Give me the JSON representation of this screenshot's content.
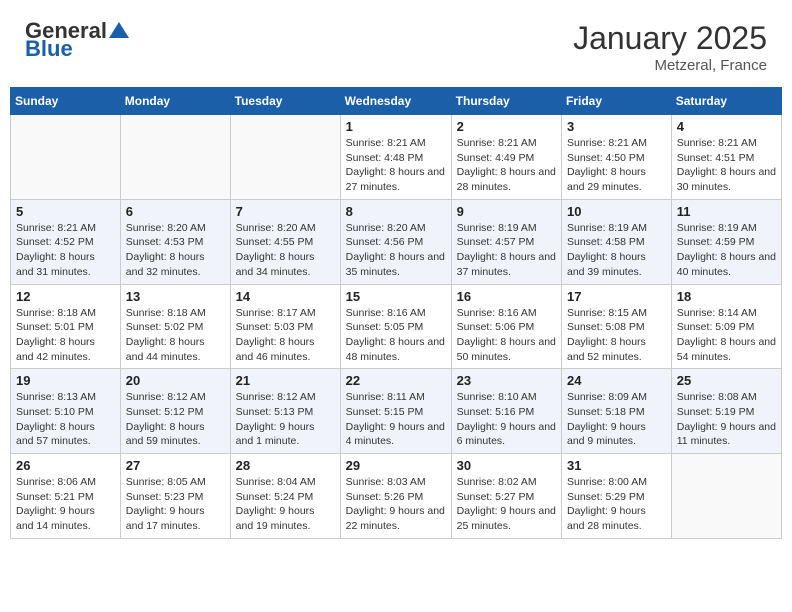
{
  "header": {
    "logo_general": "General",
    "logo_blue": "Blue",
    "month": "January 2025",
    "location": "Metzeral, France"
  },
  "weekdays": [
    "Sunday",
    "Monday",
    "Tuesday",
    "Wednesday",
    "Thursday",
    "Friday",
    "Saturday"
  ],
  "weeks": [
    [
      {
        "day": null,
        "sunrise": null,
        "sunset": null,
        "daylight": null
      },
      {
        "day": null,
        "sunrise": null,
        "sunset": null,
        "daylight": null
      },
      {
        "day": null,
        "sunrise": null,
        "sunset": null,
        "daylight": null
      },
      {
        "day": "1",
        "sunrise": "Sunrise: 8:21 AM",
        "sunset": "Sunset: 4:48 PM",
        "daylight": "Daylight: 8 hours and 27 minutes."
      },
      {
        "day": "2",
        "sunrise": "Sunrise: 8:21 AM",
        "sunset": "Sunset: 4:49 PM",
        "daylight": "Daylight: 8 hours and 28 minutes."
      },
      {
        "day": "3",
        "sunrise": "Sunrise: 8:21 AM",
        "sunset": "Sunset: 4:50 PM",
        "daylight": "Daylight: 8 hours and 29 minutes."
      },
      {
        "day": "4",
        "sunrise": "Sunrise: 8:21 AM",
        "sunset": "Sunset: 4:51 PM",
        "daylight": "Daylight: 8 hours and 30 minutes."
      }
    ],
    [
      {
        "day": "5",
        "sunrise": "Sunrise: 8:21 AM",
        "sunset": "Sunset: 4:52 PM",
        "daylight": "Daylight: 8 hours and 31 minutes."
      },
      {
        "day": "6",
        "sunrise": "Sunrise: 8:20 AM",
        "sunset": "Sunset: 4:53 PM",
        "daylight": "Daylight: 8 hours and 32 minutes."
      },
      {
        "day": "7",
        "sunrise": "Sunrise: 8:20 AM",
        "sunset": "Sunset: 4:55 PM",
        "daylight": "Daylight: 8 hours and 34 minutes."
      },
      {
        "day": "8",
        "sunrise": "Sunrise: 8:20 AM",
        "sunset": "Sunset: 4:56 PM",
        "daylight": "Daylight: 8 hours and 35 minutes."
      },
      {
        "day": "9",
        "sunrise": "Sunrise: 8:19 AM",
        "sunset": "Sunset: 4:57 PM",
        "daylight": "Daylight: 8 hours and 37 minutes."
      },
      {
        "day": "10",
        "sunrise": "Sunrise: 8:19 AM",
        "sunset": "Sunset: 4:58 PM",
        "daylight": "Daylight: 8 hours and 39 minutes."
      },
      {
        "day": "11",
        "sunrise": "Sunrise: 8:19 AM",
        "sunset": "Sunset: 4:59 PM",
        "daylight": "Daylight: 8 hours and 40 minutes."
      }
    ],
    [
      {
        "day": "12",
        "sunrise": "Sunrise: 8:18 AM",
        "sunset": "Sunset: 5:01 PM",
        "daylight": "Daylight: 8 hours and 42 minutes."
      },
      {
        "day": "13",
        "sunrise": "Sunrise: 8:18 AM",
        "sunset": "Sunset: 5:02 PM",
        "daylight": "Daylight: 8 hours and 44 minutes."
      },
      {
        "day": "14",
        "sunrise": "Sunrise: 8:17 AM",
        "sunset": "Sunset: 5:03 PM",
        "daylight": "Daylight: 8 hours and 46 minutes."
      },
      {
        "day": "15",
        "sunrise": "Sunrise: 8:16 AM",
        "sunset": "Sunset: 5:05 PM",
        "daylight": "Daylight: 8 hours and 48 minutes."
      },
      {
        "day": "16",
        "sunrise": "Sunrise: 8:16 AM",
        "sunset": "Sunset: 5:06 PM",
        "daylight": "Daylight: 8 hours and 50 minutes."
      },
      {
        "day": "17",
        "sunrise": "Sunrise: 8:15 AM",
        "sunset": "Sunset: 5:08 PM",
        "daylight": "Daylight: 8 hours and 52 minutes."
      },
      {
        "day": "18",
        "sunrise": "Sunrise: 8:14 AM",
        "sunset": "Sunset: 5:09 PM",
        "daylight": "Daylight: 8 hours and 54 minutes."
      }
    ],
    [
      {
        "day": "19",
        "sunrise": "Sunrise: 8:13 AM",
        "sunset": "Sunset: 5:10 PM",
        "daylight": "Daylight: 8 hours and 57 minutes."
      },
      {
        "day": "20",
        "sunrise": "Sunrise: 8:12 AM",
        "sunset": "Sunset: 5:12 PM",
        "daylight": "Daylight: 8 hours and 59 minutes."
      },
      {
        "day": "21",
        "sunrise": "Sunrise: 8:12 AM",
        "sunset": "Sunset: 5:13 PM",
        "daylight": "Daylight: 9 hours and 1 minute."
      },
      {
        "day": "22",
        "sunrise": "Sunrise: 8:11 AM",
        "sunset": "Sunset: 5:15 PM",
        "daylight": "Daylight: 9 hours and 4 minutes."
      },
      {
        "day": "23",
        "sunrise": "Sunrise: 8:10 AM",
        "sunset": "Sunset: 5:16 PM",
        "daylight": "Daylight: 9 hours and 6 minutes."
      },
      {
        "day": "24",
        "sunrise": "Sunrise: 8:09 AM",
        "sunset": "Sunset: 5:18 PM",
        "daylight": "Daylight: 9 hours and 9 minutes."
      },
      {
        "day": "25",
        "sunrise": "Sunrise: 8:08 AM",
        "sunset": "Sunset: 5:19 PM",
        "daylight": "Daylight: 9 hours and 11 minutes."
      }
    ],
    [
      {
        "day": "26",
        "sunrise": "Sunrise: 8:06 AM",
        "sunset": "Sunset: 5:21 PM",
        "daylight": "Daylight: 9 hours and 14 minutes."
      },
      {
        "day": "27",
        "sunrise": "Sunrise: 8:05 AM",
        "sunset": "Sunset: 5:23 PM",
        "daylight": "Daylight: 9 hours and 17 minutes."
      },
      {
        "day": "28",
        "sunrise": "Sunrise: 8:04 AM",
        "sunset": "Sunset: 5:24 PM",
        "daylight": "Daylight: 9 hours and 19 minutes."
      },
      {
        "day": "29",
        "sunrise": "Sunrise: 8:03 AM",
        "sunset": "Sunset: 5:26 PM",
        "daylight": "Daylight: 9 hours and 22 minutes."
      },
      {
        "day": "30",
        "sunrise": "Sunrise: 8:02 AM",
        "sunset": "Sunset: 5:27 PM",
        "daylight": "Daylight: 9 hours and 25 minutes."
      },
      {
        "day": "31",
        "sunrise": "Sunrise: 8:00 AM",
        "sunset": "Sunset: 5:29 PM",
        "daylight": "Daylight: 9 hours and 28 minutes."
      },
      {
        "day": null,
        "sunrise": null,
        "sunset": null,
        "daylight": null
      }
    ]
  ]
}
